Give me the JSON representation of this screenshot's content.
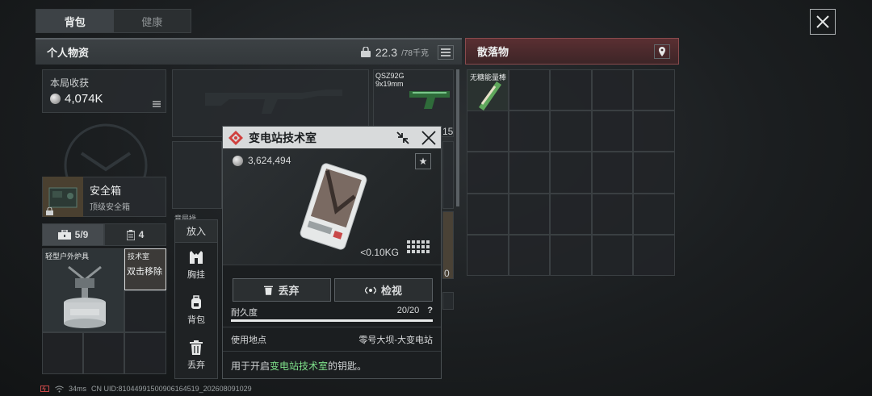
{
  "tabs": [
    {
      "label": "背包"
    },
    {
      "label": "健康"
    }
  ],
  "personal": {
    "title": "个人物资",
    "weight": "22.3",
    "weight_cap": "/78千克",
    "income_label": "本局收获",
    "income_value": "4,074K",
    "safebox_name": "安全箱",
    "safebox_sub": "顶级安全箱",
    "count_a": "5/9",
    "count_b": "4",
    "item_stove": "轻型户外炉具",
    "item_tech_tag": "技术室",
    "item_tech_hint": "双击移除",
    "weapon_name": "QSZ92G",
    "weapon_ammo": "9x19mm",
    "partial_num": "15",
    "partial_label": "竞局操",
    "partial_zero": "0"
  },
  "loot": {
    "title": "散落物",
    "item_label": "无糖能量棒"
  },
  "actions": {
    "header": "放入",
    "items": [
      {
        "label": "胸挂",
        "icon": "vest-icon"
      },
      {
        "label": "背包",
        "icon": "backpack-icon"
      },
      {
        "label": "丢弃",
        "icon": "trash-icon"
      }
    ]
  },
  "popup": {
    "title": "变电站技术室",
    "price": "3,624,494",
    "weight": "<0.10KG",
    "discard": "丢弃",
    "inspect": "检视",
    "durability_label": "耐久度",
    "durability_value": "20/20",
    "durability_fraction": 1.0,
    "help": "?",
    "use_label": "使用地点",
    "use_value": "零号大坝-大变电站",
    "desc_prefix": "用于开启",
    "desc_highlight": "变电站技术室",
    "desc_suffix": "的钥匙。"
  },
  "status": {
    "ping": "34ms",
    "uid": "CN UID:810449915009061645​19_202608091029"
  },
  "colors": {
    "highlight": "#7ee08a",
    "loot_header": "#5a2f32",
    "popup_icon": "#d0403e"
  }
}
